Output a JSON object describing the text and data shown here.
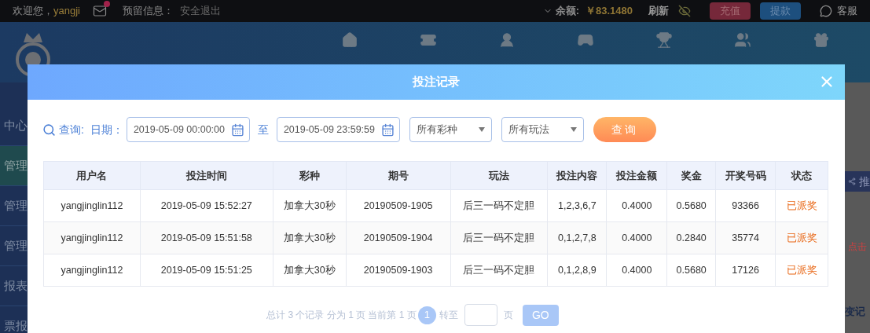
{
  "top_bar": {
    "welcome": "欢迎您，",
    "username": "yangji",
    "mail_unread": true,
    "reserved_label": "预留信息：",
    "logout": "安全退出",
    "balance_label": "余额:",
    "balance": "￥83.1480",
    "refresh": "刷新",
    "deposit": "充值",
    "withdraw": "提款",
    "service": "客服"
  },
  "nav": [
    {
      "kind": "home"
    },
    {
      "kind": "ticket"
    },
    {
      "kind": "person"
    },
    {
      "kind": "slot"
    },
    {
      "kind": "trophy"
    },
    {
      "kind": "users"
    },
    {
      "kind": "gift"
    }
  ],
  "sidebar": {
    "items": [
      {
        "label": "中心",
        "selected": false
      },
      {
        "label": "管理",
        "selected": true
      },
      {
        "label": "管理",
        "selected": false
      },
      {
        "label": "管理",
        "selected": false
      },
      {
        "label": "报表",
        "selected": false
      },
      {
        "label": "票报",
        "selected": false
      }
    ]
  },
  "right_strip": {
    "promo": "推",
    "notice": "点击",
    "record": "变记"
  },
  "modal": {
    "title": "投注记录",
    "query_label": "查询:",
    "date_label": "日期：",
    "start_date": "2019-05-09 00:00:00",
    "separator": "至",
    "end_date": "2019-05-09 23:59:59",
    "selects": [
      "所有彩种",
      "所有玩法"
    ],
    "query_button": "查询",
    "table": {
      "columns": [
        "用户名",
        "投注时间",
        "彩种",
        "期号",
        "玩法",
        "投注内容",
        "投注金额",
        "奖金",
        "开奖号码",
        "状态"
      ],
      "rows": [
        [
          "yangjinglin112",
          "2019-05-09 15:52:27",
          "加拿大30秒",
          "20190509-1905",
          "后三一码不定胆",
          "1,2,3,6,7",
          "0.4000",
          "0.5680",
          "93366",
          "已派奖"
        ],
        [
          "yangjinglin112",
          "2019-05-09 15:51:58",
          "加拿大30秒",
          "20190509-1904",
          "后三一码不定胆",
          "0,1,2,7,8",
          "0.4000",
          "0.2840",
          "35774",
          "已派奖"
        ],
        [
          "yangjinglin112",
          "2019-05-09 15:51:25",
          "加拿大30秒",
          "20190509-1903",
          "后三一码不定胆",
          "0,1,2,8,9",
          "0.4000",
          "0.5680",
          "17126",
          "已派奖"
        ]
      ]
    },
    "pagination": {
      "summary": "总计 3 个记录 分为 1 页 当前第 1 页",
      "pages": [
        {
          "label": "1",
          "selected": true
        }
      ],
      "goto_label": "转至",
      "page_unit": "页",
      "go_button": "GO"
    }
  }
}
